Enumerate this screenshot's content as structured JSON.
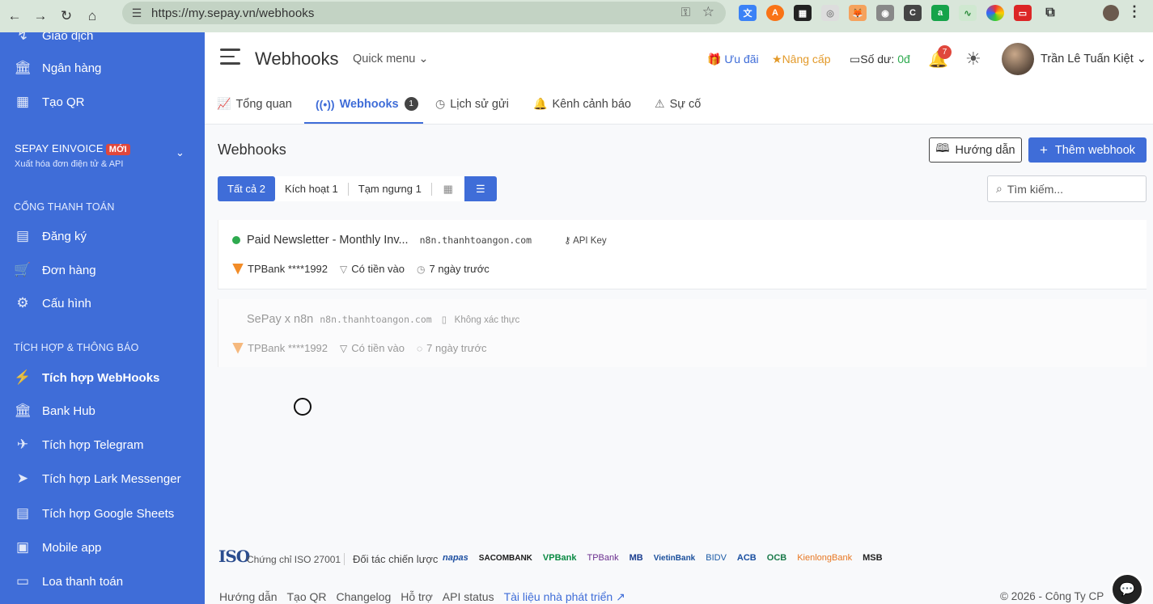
{
  "browser": {
    "url": "https://my.sepay.vn/webhooks",
    "back_icon": "←",
    "forward_icon": "→",
    "reload_icon": "↻",
    "home_icon": "⌂"
  },
  "sidebar": {
    "top_items": [
      {
        "label": "Giao dịch",
        "icon": "↯"
      },
      {
        "label": "Ngân hàng",
        "icon": "🏛"
      },
      {
        "label": "Tạo QR",
        "icon": "▦"
      }
    ],
    "einvoice": {
      "title": "SEPAY EINVOICE",
      "badge": "MỚI",
      "subtitle": "Xuất hóa đơn điện tử & API"
    },
    "payment_section": "CỔNG THANH TOÁN",
    "payment_items": [
      {
        "label": "Đăng ký",
        "icon": "▤"
      },
      {
        "label": "Đơn hàng",
        "icon": "🛒"
      },
      {
        "label": "Cấu hình",
        "icon": "⚙"
      }
    ],
    "integration_section": "TÍCH HỢP & THÔNG BÁO",
    "integration_items": [
      {
        "label": "Tích hợp WebHooks",
        "icon": "⚡"
      },
      {
        "label": "Bank Hub",
        "icon": "🏛"
      },
      {
        "label": "Tích hợp Telegram",
        "icon": "✈"
      },
      {
        "label": "Tích hợp Lark Messenger",
        "icon": "➤"
      },
      {
        "label": "Tích hợp Google Sheets",
        "icon": "▤"
      },
      {
        "label": "Mobile app",
        "icon": "▣"
      },
      {
        "label": "Loa thanh toán",
        "icon": "▭"
      }
    ]
  },
  "header": {
    "title": "Webhooks",
    "quick_menu": "Quick menu",
    "promo": "Ưu đãi",
    "upgrade": "Nâng cấp",
    "balance_label": "Số dư:",
    "balance_value": "0đ",
    "notif_count": "7",
    "user_name": "Trần Lê Tuấn Kiệt"
  },
  "tabs": [
    {
      "label": "Tổng quan",
      "icon": "📈"
    },
    {
      "label": "Webhooks",
      "icon": "((•))",
      "count": "1"
    },
    {
      "label": "Lịch sử gửi",
      "icon": "◷"
    },
    {
      "label": "Kênh cảnh báo",
      "icon": "🔔"
    },
    {
      "label": "Sự cố",
      "icon": "⚠"
    }
  ],
  "content": {
    "section_title": "Webhooks",
    "guide_button": "Hướng dẫn",
    "add_button": "Thêm webhook",
    "filters": {
      "all": "Tất cả 2",
      "active": "Kích hoạt 1",
      "paused": "Tạm ngưng 1"
    },
    "search_placeholder": "Tìm kiếm...",
    "webhooks": [
      {
        "name": "Paid Newsletter - Monthly Inv...",
        "url": "n8n.thanhtoangon.com",
        "auth": "API Key",
        "bank": "TPBank ****1992",
        "filter": "Có tiền vào",
        "time": "7 ngày trước"
      },
      {
        "name": "SePay x n8n",
        "url": "n8n.thanhtoangon.com",
        "auth": "Không xác thực",
        "bank": "TPBank ****1992",
        "filter": "Có tiền vào",
        "time": "7 ngày trước"
      }
    ]
  },
  "footer": {
    "iso_logo": "ISO",
    "iso_label": "Chứng chỉ ISO 27001",
    "partners_label": "Đối tác chiến lược",
    "banks": [
      {
        "name": "napas",
        "color": "#1d4fa1"
      },
      {
        "name": "SACOMBANK",
        "color": "#1a1a1a"
      },
      {
        "name": "VPBank",
        "color": "#0a8a43"
      },
      {
        "name": "TPBank",
        "color": "#6b2f8f"
      },
      {
        "name": "MB",
        "color": "#1a3d8f"
      },
      {
        "name": "VietinBank",
        "color": "#1a4f9c"
      },
      {
        "name": "BIDV",
        "color": "#1a5aa6"
      },
      {
        "name": "ACB",
        "color": "#1a4fa1"
      },
      {
        "name": "OCB",
        "color": "#1a7a4a"
      },
      {
        "name": "KienlongBank",
        "color": "#e87722"
      },
      {
        "name": "MSB",
        "color": "#222222"
      }
    ],
    "links": [
      "Hướng dẫn",
      "Tạo QR",
      "Changelog",
      "Hỗ trợ",
      "API status"
    ],
    "dev_link": "Tài liệu nhà phát triển",
    "copyright": "© 2026 - Công Ty CP"
  }
}
